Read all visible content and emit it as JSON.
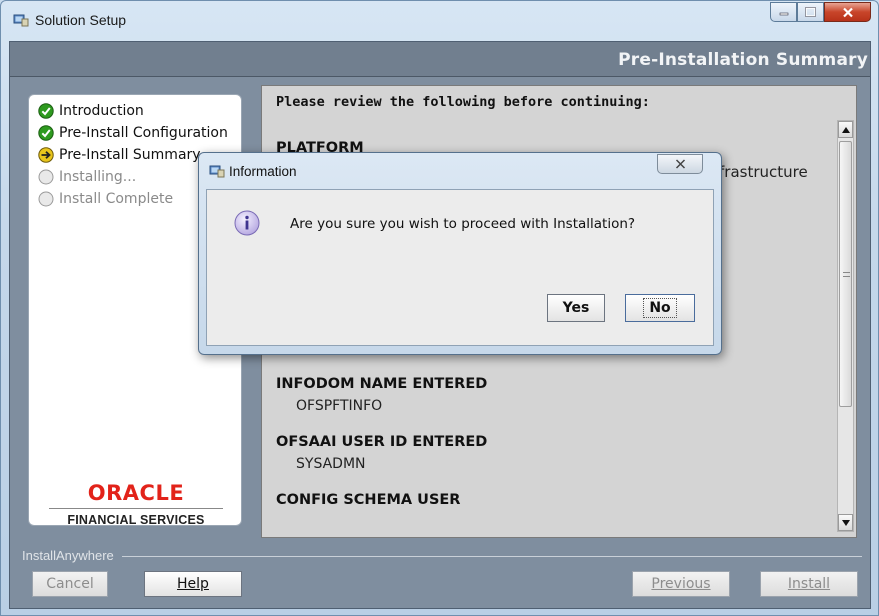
{
  "window": {
    "title": "Solution Setup",
    "icon": "app-installer-icon"
  },
  "header": {
    "title": "Pre-Installation Summary"
  },
  "steps": [
    {
      "label": "Introduction",
      "status": "done",
      "icon": "check-icon"
    },
    {
      "label": "Pre-Install Configuration",
      "status": "done",
      "icon": "check-icon"
    },
    {
      "label": "Pre-Install Summary",
      "status": "current",
      "icon": "arrow-right-icon"
    },
    {
      "label": "Installing...",
      "status": "pending",
      "icon": "circle-icon"
    },
    {
      "label": "Install Complete",
      "status": "pending",
      "icon": "circle-icon"
    }
  ],
  "branding": {
    "logo_word": "ORACLE",
    "logo_sub": "FINANCIAL SERVICES"
  },
  "content": {
    "heading": "Please review the following before continuing:",
    "platform_title": "PLATFORM",
    "platform_value_tail": "frastructure",
    "sections": [
      {
        "title": "INFODOM NAME ENTERED",
        "value": "OFSPFTINFO"
      },
      {
        "title": "OFSAAI USER ID ENTERED",
        "value": "SYSADMN"
      },
      {
        "title": "CONFIG SCHEMA USER",
        "value": ""
      }
    ]
  },
  "footer": {
    "label": "InstallAnywhere",
    "cancel_label": "Cancel",
    "help_label": "Help",
    "previous_label": "Previous",
    "install_label": "Install"
  },
  "dialog": {
    "title": "Information",
    "message": "Are you sure you wish to proceed with Installation?",
    "yes_label": "Yes",
    "no_label": "No"
  },
  "colors": {
    "oracle_red": "#e2231a",
    "header_bg": "#717f8f",
    "step_done_green": "#2e9a1f",
    "step_current_yellow": "#e8c51c"
  }
}
